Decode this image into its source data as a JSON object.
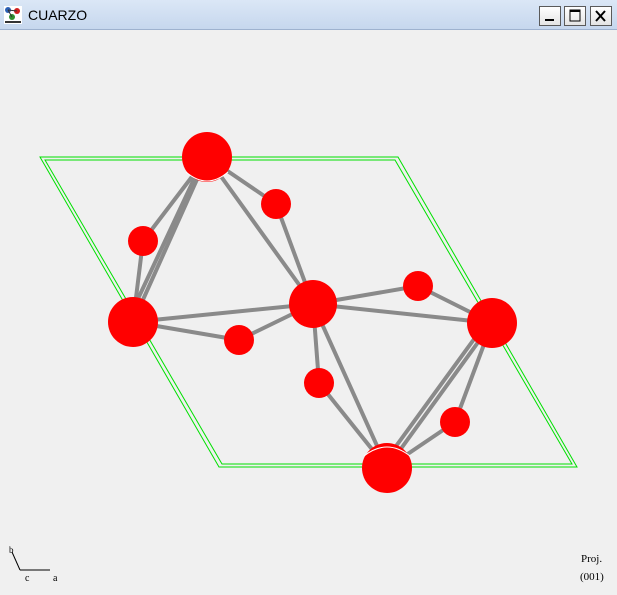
{
  "window": {
    "title": "CUARZO",
    "controls": [
      "minimize",
      "maximize",
      "close"
    ]
  },
  "icons": {
    "app": "molecule-app-icon",
    "minimize": "minimize-icon",
    "maximize": "maximize-icon",
    "close": "close-icon"
  },
  "view": {
    "projection_label": "Proj.",
    "projection_value": "(001)",
    "axis_labels": {
      "b": "b",
      "c": "c",
      "a": "a"
    }
  },
  "colors": {
    "background": "#f0f0f0",
    "atom": "#ff0000",
    "bond": "#8a8a8a",
    "unit_cell": "#00e000"
  }
}
